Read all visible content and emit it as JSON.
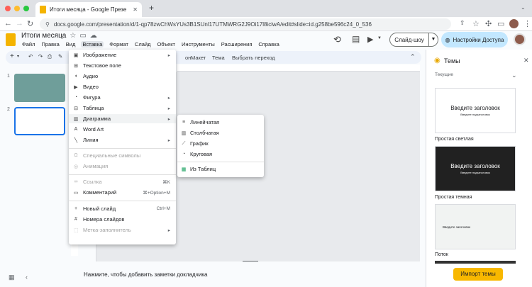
{
  "browser": {
    "tab_title": "Итоги месяца - Google Презе",
    "url": "docs.google.com/presentation/d/1-qp78zwChWsYUs3B1SUnl17UTMWRG2J9Oi17l8iciwA/edit#slide=id.g258be596c24_0_536",
    "new_tab": "+"
  },
  "doc": {
    "title": "Итоги месяца",
    "menu": [
      "Файл",
      "Правка",
      "Вид",
      "Вставка",
      "Формат",
      "Слайд",
      "Объект",
      "Инструменты",
      "Расширения",
      "Справка"
    ],
    "slideshow_label": "Слайд-шоу",
    "share_label": "Настройки Доступа"
  },
  "toolbar": {
    "items": [
      "он",
      "Макет",
      "Тема",
      "Выбрать переход"
    ]
  },
  "filmstrip": {
    "slide_numbers": [
      "1",
      "2"
    ]
  },
  "insert_menu": {
    "items": [
      {
        "icon": "image-icon",
        "label": "Изображение",
        "shortcut": "",
        "arrow": true,
        "disabled": false
      },
      {
        "icon": "textbox-icon",
        "label": "Текстовое поле",
        "shortcut": "",
        "arrow": false,
        "disabled": false
      },
      {
        "icon": "audio-icon",
        "label": "Аудио",
        "shortcut": "",
        "arrow": false,
        "disabled": false
      },
      {
        "icon": "video-icon",
        "label": "Видео",
        "shortcut": "",
        "arrow": false,
        "disabled": false
      },
      {
        "icon": "shape-icon",
        "label": "Фигура",
        "shortcut": "",
        "arrow": true,
        "disabled": false
      },
      {
        "icon": "table-icon",
        "label": "Таблица",
        "shortcut": "",
        "arrow": true,
        "disabled": false
      },
      {
        "icon": "chart-icon",
        "label": "Диаграмма",
        "shortcut": "",
        "arrow": true,
        "disabled": false
      },
      {
        "icon": "wordart-icon",
        "label": "Word Art",
        "shortcut": "",
        "arrow": false,
        "disabled": false
      },
      {
        "icon": "line-icon",
        "label": "Линия",
        "shortcut": "",
        "arrow": true,
        "disabled": false
      },
      {
        "icon": "omega-icon",
        "label": "Специальные символы",
        "shortcut": "",
        "arrow": false,
        "disabled": true
      },
      {
        "icon": "animation-icon",
        "label": "Анимация",
        "shortcut": "",
        "arrow": false,
        "disabled": true
      },
      {
        "icon": "link-icon",
        "label": "Ссылка",
        "shortcut": "⌘K",
        "arrow": false,
        "disabled": true
      },
      {
        "icon": "comment-icon",
        "label": "Комментарий",
        "shortcut": "⌘+Option+M",
        "arrow": false,
        "disabled": false
      },
      {
        "icon": "plus-icon",
        "label": "Новый слайд",
        "shortcut": "Ctrl+M",
        "arrow": false,
        "disabled": false
      },
      {
        "icon": "slide-number-icon",
        "label": "Номера слайдов",
        "shortcut": "",
        "arrow": false,
        "disabled": false
      },
      {
        "icon": "placeholder-icon",
        "label": "Метка-заполнитель",
        "shortcut": "",
        "arrow": true,
        "disabled": true
      }
    ]
  },
  "chart_submenu": {
    "items": [
      {
        "icon": "bar-chart-icon",
        "label": "Линейчатая"
      },
      {
        "icon": "column-chart-icon",
        "label": "Столбчатая"
      },
      {
        "icon": "line-chart-icon",
        "label": "График"
      },
      {
        "icon": "pie-chart-icon",
        "label": "Круговая"
      },
      {
        "icon": "sheets-icon",
        "label": "Из Таблиц"
      }
    ]
  },
  "notes": {
    "placeholder": "Нажмите, чтобы добавить заметки докладчика"
  },
  "themes_panel": {
    "title": "Темы",
    "section": "Текущие",
    "themes": [
      {
        "name": "Простая светлая",
        "preview_title": "Введите заголовок",
        "preview_sub": "Введите подзаголовок",
        "bg": "#ffffff",
        "fg": "#202124"
      },
      {
        "name": "Простая темная",
        "preview_title": "Введите заголовок",
        "preview_sub": "Введите подзаголовок",
        "bg": "#212121",
        "fg": "#ffffff"
      },
      {
        "name": "Поток",
        "preview_title": "Введите заголовок",
        "preview_sub": "",
        "bg": "#f1f3f2",
        "fg": "#202124"
      }
    ],
    "import_label": "Импорт темы"
  }
}
